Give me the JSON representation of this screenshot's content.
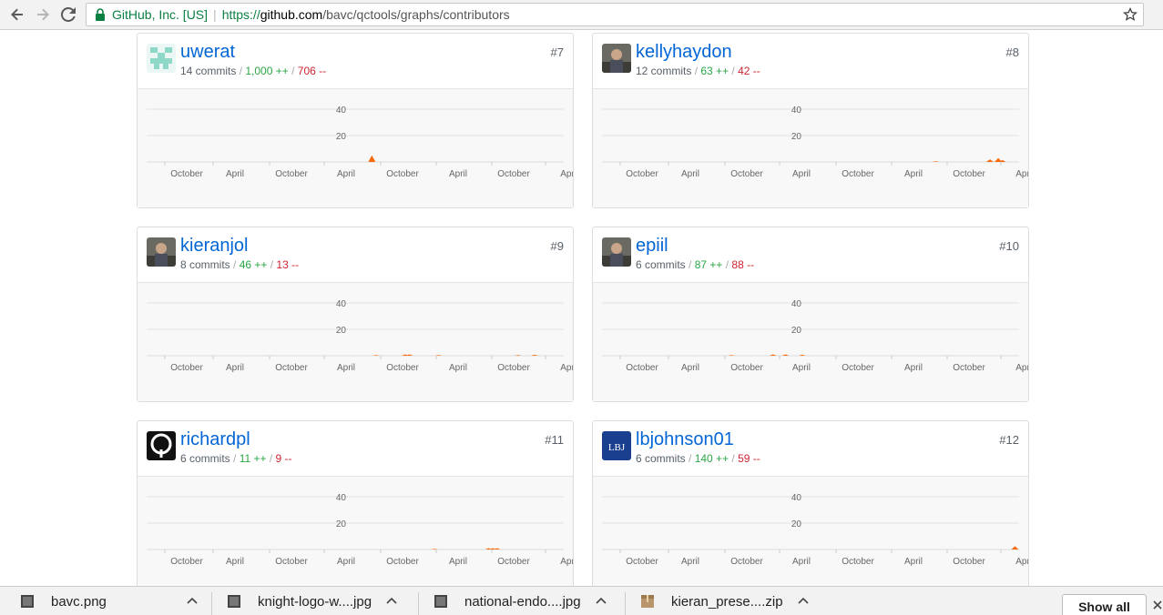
{
  "browser": {
    "org": "GitHub, Inc. [US]",
    "url_scheme": "https://",
    "url_host": "github.com",
    "url_path": "/bavc/qctools/graphs/contributors"
  },
  "axis": {
    "x_ticks": [
      "October",
      "April",
      "October",
      "April",
      "October",
      "April",
      "October",
      "Apr"
    ],
    "y_ticks": [
      "40",
      "20"
    ]
  },
  "contributors": [
    {
      "username": "uwerat",
      "commits": "14 commits",
      "additions": "1,000 ++",
      "deletions": "706 --",
      "rank": "#7",
      "avatar": "identicon-avatar",
      "accent": "#f66a0a",
      "chart_data": {
        "type": "area",
        "x": [
          0.54
        ],
        "y": [
          5
        ],
        "ylim": [
          0,
          40
        ]
      }
    },
    {
      "username": "kellyhaydon",
      "commits": "12 commits",
      "additions": "63 ++",
      "deletions": "42 --",
      "rank": "#8",
      "avatar": "photo-avatar",
      "accent": "#f66a0a",
      "chart_data": {
        "type": "area",
        "x": [
          0.8,
          0.93,
          0.95,
          0.96
        ],
        "y": [
          0.5,
          2,
          3,
          1.5
        ],
        "ylim": [
          0,
          40
        ]
      }
    },
    {
      "username": "kieranjol",
      "commits": "8 commits",
      "additions": "46 ++",
      "deletions": "13 --",
      "rank": "#9",
      "avatar": "photo-avatar",
      "accent": "#f66a0a",
      "chart_data": {
        "type": "area",
        "x": [
          0.55,
          0.62,
          0.63,
          0.7,
          0.89,
          0.93
        ],
        "y": [
          0.5,
          1,
          1,
          0.5,
          0.5,
          0.8
        ],
        "ylim": [
          0,
          40
        ]
      }
    },
    {
      "username": "epiil",
      "commits": "6 commits",
      "additions": "87 ++",
      "deletions": "88 --",
      "rank": "#10",
      "avatar": "photo-avatar",
      "accent": "#f66a0a",
      "chart_data": {
        "type": "area",
        "x": [
          0.31,
          0.41,
          0.44,
          0.48
        ],
        "y": [
          0.5,
          1,
          1,
          0.8
        ],
        "ylim": [
          0,
          40
        ]
      }
    },
    {
      "username": "richardpl",
      "commits": "6 commits",
      "additions": "11 ++",
      "deletions": "9 --",
      "rank": "#11",
      "avatar": "ring-avatar",
      "accent": "#f66a0a",
      "chart_data": {
        "type": "area",
        "x": [
          0.69,
          0.82,
          0.83,
          0.84
        ],
        "y": [
          0.5,
          1,
          1,
          1
        ],
        "ylim": [
          0,
          40
        ]
      }
    },
    {
      "username": "lbjohnson01",
      "commits": "6 commits",
      "additions": "140 ++",
      "deletions": "59 --",
      "rank": "#12",
      "avatar": "initials-avatar",
      "accent": "#f66a0a",
      "avatar_text": "LBJ",
      "chart_data": {
        "type": "area",
        "x": [
          0.99
        ],
        "y": [
          2.5
        ],
        "ylim": [
          0,
          40
        ]
      }
    }
  ],
  "downloads": [
    {
      "name": "bavc.png",
      "icon": "image-file-icon"
    },
    {
      "name": "knight-logo-w....jpg",
      "icon": "image-file-icon"
    },
    {
      "name": "national-endo....jpg",
      "icon": "image-file-icon"
    },
    {
      "name": "kieran_prese....zip",
      "icon": "archive-file-icon"
    }
  ],
  "shelf": {
    "show_all": "Show all"
  }
}
